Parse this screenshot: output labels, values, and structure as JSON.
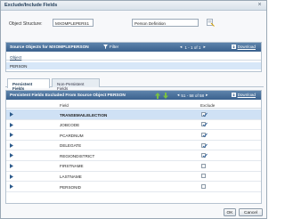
{
  "dialog": {
    "title": "Exclude/Include Fields"
  },
  "object": {
    "label": "Object Structure:",
    "value": "MXOMPLEPERS1",
    "description": "Person Definition"
  },
  "source_panel": {
    "title": "Source Objects for MXOMPLEPERSON",
    "filter_label": "Filter",
    "pager_text": "1 - 1 of 1",
    "download_label": "Download",
    "column_header": "Object",
    "rows": [
      "PERSON"
    ]
  },
  "tabs": [
    {
      "label": "Persistent Fields",
      "active": true
    },
    {
      "label": "Non-Persistent Fields",
      "active": false
    }
  ],
  "fields_panel": {
    "title": "Persistent Fields Excluded From Source Object PERSON",
    "pager_text": "51 - 58 of 58",
    "download_label": "Download",
    "col_field": "Field",
    "col_exclude": "Exclude",
    "rows": [
      {
        "field": "TRANSEMAILELECTION",
        "excluded": true
      },
      {
        "field": "JOBCODE",
        "excluded": true
      },
      {
        "field": "PCARDNUM",
        "excluded": true
      },
      {
        "field": "DELEGATE",
        "excluded": true
      },
      {
        "field": "REGIONDISTRICT",
        "excluded": true
      },
      {
        "field": "FIRSTNAME",
        "excluded": false
      },
      {
        "field": "LASTNAME",
        "excluded": false
      },
      {
        "field": "PERSONID",
        "excluded": false
      }
    ]
  },
  "buttons": {
    "ok": "OK",
    "cancel": "Cancel"
  }
}
